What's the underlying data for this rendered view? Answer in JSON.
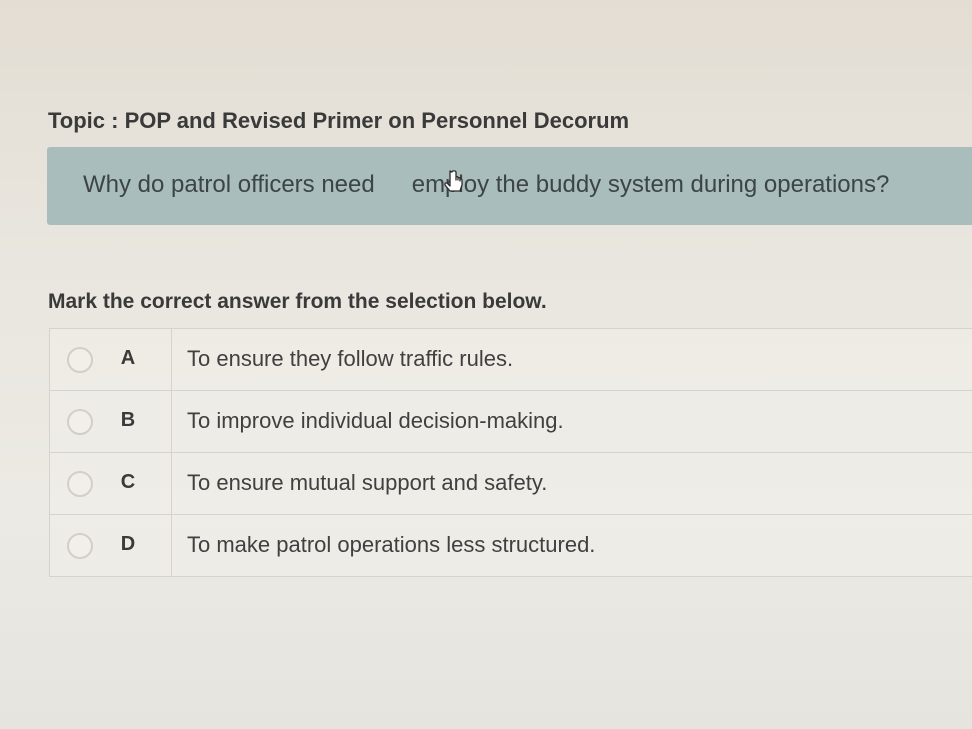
{
  "topic": {
    "label": "Topic : POP and Revised Primer on Personnel Decorum"
  },
  "question": {
    "text_before": "Why do patrol officers need",
    "text_after": "employ the buddy system during operations?",
    "cursor_icon": "pointer-cursor-icon"
  },
  "instruction": "Mark the correct answer from the selection below.",
  "options": [
    {
      "letter": "A",
      "text": "To ensure they follow traffic rules."
    },
    {
      "letter": "B",
      "text": "To improve individual decision-making."
    },
    {
      "letter": "C",
      "text": "To ensure mutual support and safety."
    },
    {
      "letter": "D",
      "text": "To make patrol operations less structured."
    }
  ],
  "colors": {
    "question_box": "#a9bdbd",
    "text": "#3a3a3a"
  }
}
